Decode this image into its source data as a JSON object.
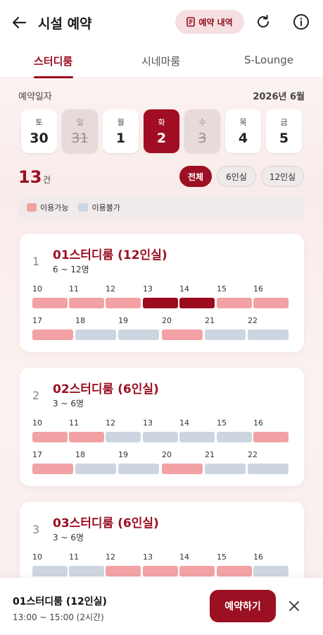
{
  "header": {
    "title": "시설 예약",
    "history_label": "예약 내역",
    "icons": {
      "back": "arrow-left-icon",
      "history": "receipt-icon",
      "refresh": "refresh-icon",
      "info": "info-icon"
    }
  },
  "tabs": [
    {
      "label": "스터디룸",
      "active": true
    },
    {
      "label": "시네마룸",
      "active": false
    },
    {
      "label": "S-Lounge",
      "active": false
    }
  ],
  "date_section": {
    "label": "예약일자",
    "month": "2026년 6월",
    "days": [
      {
        "dow": "토",
        "num": "30",
        "state": "normal"
      },
      {
        "dow": "일",
        "num": "31",
        "state": "disabled"
      },
      {
        "dow": "월",
        "num": "1",
        "state": "normal"
      },
      {
        "dow": "화",
        "num": "2",
        "state": "selected"
      },
      {
        "dow": "수",
        "num": "3",
        "state": "disabled"
      },
      {
        "dow": "목",
        "num": "4",
        "state": "normal"
      },
      {
        "dow": "금",
        "num": "5",
        "state": "normal"
      }
    ]
  },
  "results": {
    "count": "13",
    "unit": "건",
    "filters": [
      {
        "label": "전체",
        "active": true
      },
      {
        "label": "6인실",
        "active": false
      },
      {
        "label": "12인실",
        "active": false
      }
    ]
  },
  "legend": [
    {
      "label": "이용가능",
      "color": "#f2a2a4"
    },
    {
      "label": "이용불가",
      "color": "#cdd5e0"
    }
  ],
  "colors": {
    "accent": "#9b1022",
    "available": "#f2a2a4",
    "unavailable": "#cdd5e0",
    "selected": "#9b0c1e"
  },
  "hours_row1": [
    "10",
    "11",
    "12",
    "13",
    "14",
    "15",
    "16"
  ],
  "hours_row2": [
    "17",
    "18",
    "19",
    "20",
    "21",
    "22"
  ],
  "rooms": [
    {
      "index": "1",
      "name": "01스터디룸 (12인실)",
      "capacity": "6 ~ 12명",
      "row1": [
        "available",
        "available",
        "available",
        "selected",
        "selected",
        "available",
        "available"
      ],
      "row2": [
        "available",
        "unavailable",
        "unavailable",
        "available",
        "unavailable",
        "unavailable"
      ]
    },
    {
      "index": "2",
      "name": "02스터디룸 (6인실)",
      "capacity": "3 ~ 6명",
      "row1": [
        "available",
        "available",
        "unavailable",
        "unavailable",
        "unavailable",
        "unavailable",
        "available"
      ],
      "row2": [
        "available",
        "unavailable",
        "unavailable",
        "available",
        "unavailable",
        "unavailable"
      ]
    },
    {
      "index": "3",
      "name": "03스터디룸 (6인실)",
      "capacity": "3 ~ 6명",
      "row1": [
        "unavailable",
        "unavailable",
        "available",
        "available",
        "available",
        "available",
        "unavailable"
      ],
      "row2": []
    }
  ],
  "bottom_bar": {
    "room": "01스터디룸 (12인실)",
    "time": "13:00 ~ 15:00 (2시간)",
    "reserve_label": "예약하기",
    "close_icon": "close-icon"
  }
}
